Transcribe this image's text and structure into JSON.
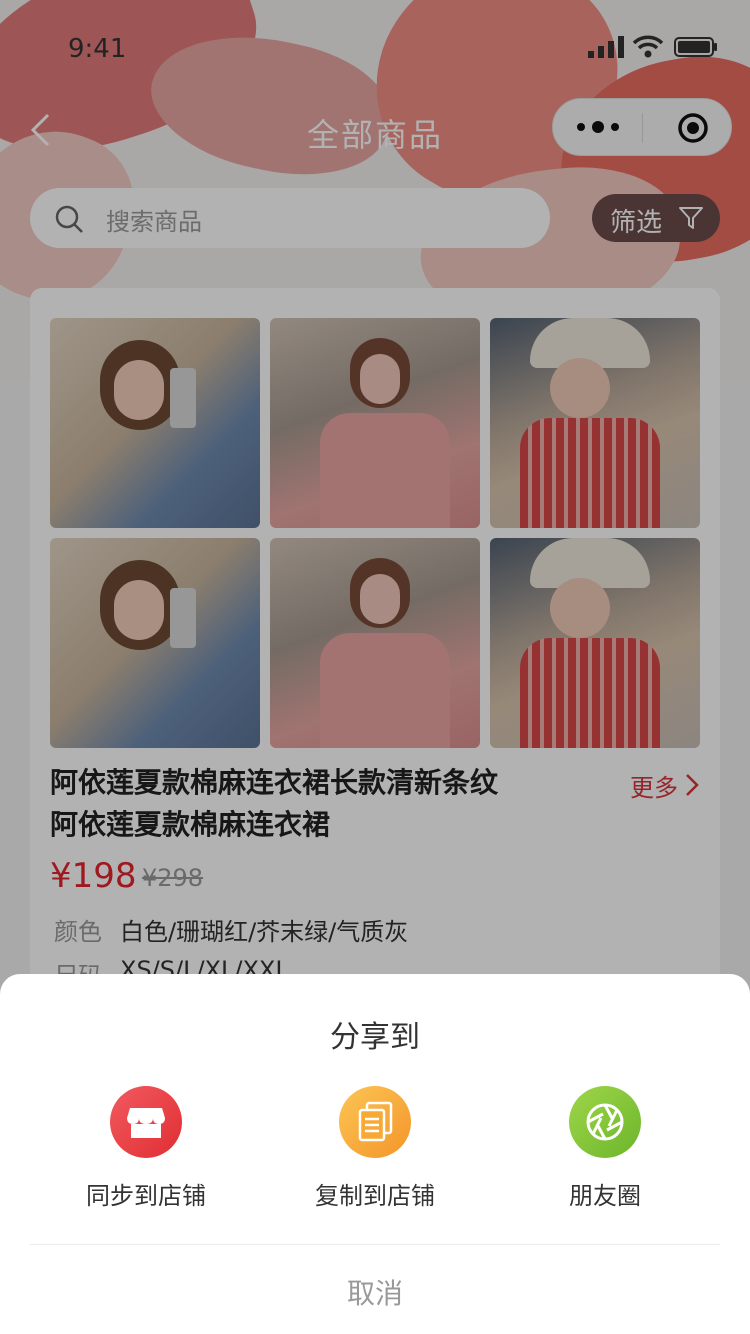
{
  "status_bar": {
    "time": "9:41"
  },
  "nav": {
    "title": "全部商品"
  },
  "search": {
    "placeholder": "搜索商品",
    "filter_label": "筛选"
  },
  "product": {
    "title_line1": "阿依莲夏款棉麻连衣裙长款清新条纹",
    "title_line2": "阿依莲夏款棉麻连衣裙",
    "more_label": "更多",
    "price": "¥198",
    "original_price": "¥298",
    "specs": [
      {
        "key": "颜色",
        "value": "白色/珊瑚红/芥末绿/气质灰"
      },
      {
        "key": "尺码",
        "value": "XS/S/L/XL/XXL"
      }
    ]
  },
  "share_sheet": {
    "title": "分享到",
    "options": [
      {
        "label": "同步到店铺",
        "icon": "store-icon",
        "color": "#e8353c"
      },
      {
        "label": "复制到店铺",
        "icon": "copy-icon",
        "color": "#f8a933"
      },
      {
        "label": "朋友圈",
        "icon": "moments-icon",
        "color": "#7fc52f"
      }
    ],
    "cancel_label": "取消"
  },
  "colors": {
    "accent_red": "#e4262e",
    "overlay": "rgba(0,0,0,0.30)"
  }
}
